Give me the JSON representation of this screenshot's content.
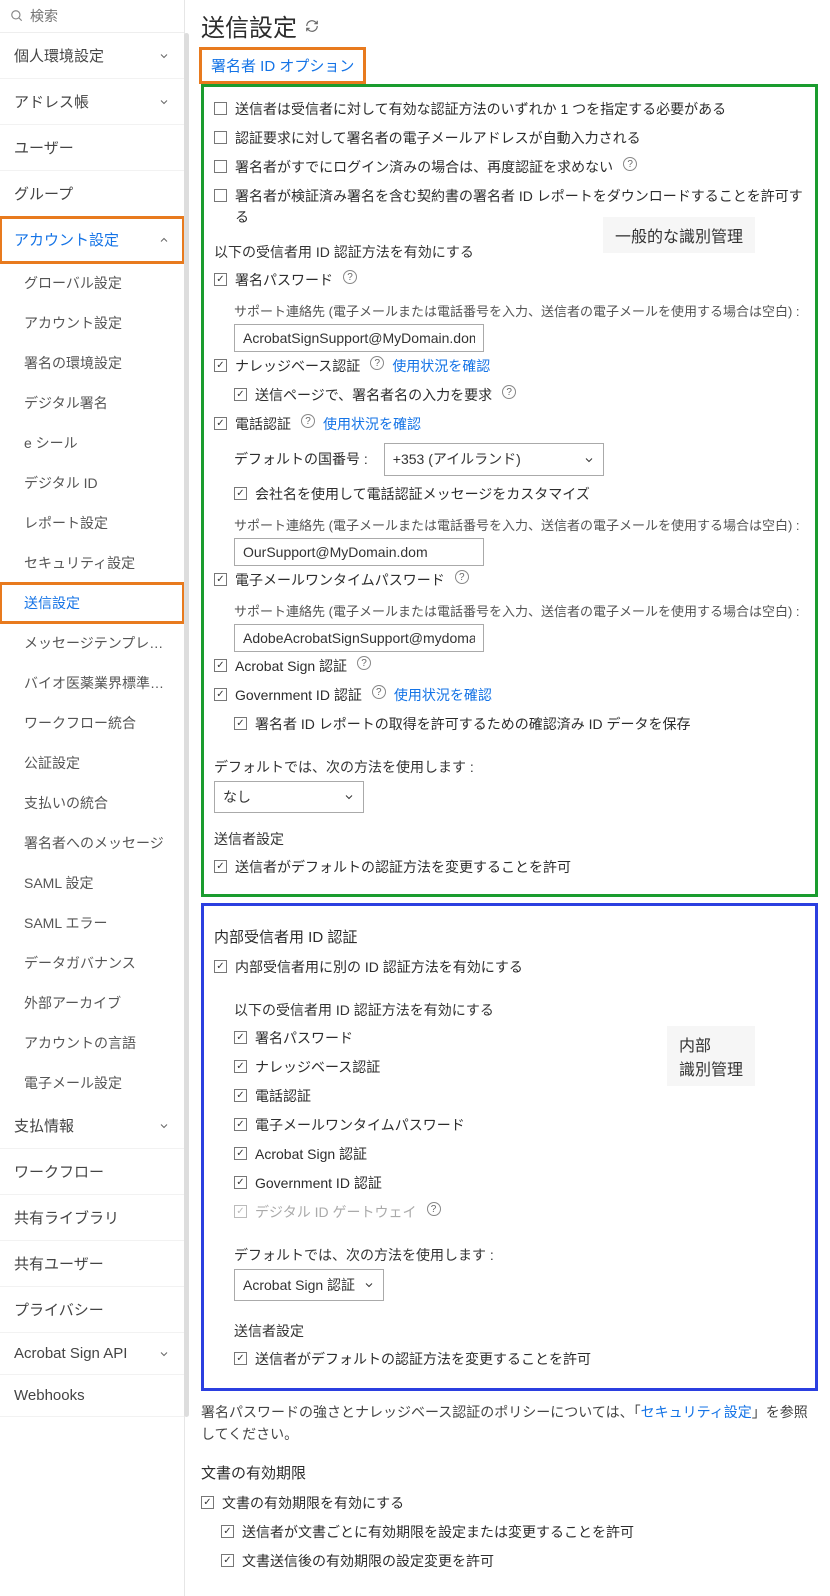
{
  "search": {
    "placeholder": "検索"
  },
  "sidebar": {
    "top": [
      {
        "label": "個人環境設定",
        "exp": "down"
      },
      {
        "label": "アドレス帳",
        "exp": "down"
      },
      {
        "label": "ユーザー"
      },
      {
        "label": "グループ"
      },
      {
        "label": "アカウント設定",
        "exp": "up",
        "highlight": true,
        "active": true
      }
    ],
    "sub": [
      "グローバル設定",
      "アカウント設定",
      "署名の環境設定",
      "デジタル署名",
      "e シール",
      "デジタル ID",
      "レポート設定",
      "セキュリティ設定",
      "送信設定",
      "メッセージテンプレ…",
      "バイオ医薬業界標準…",
      "ワークフロー統合",
      "公証設定",
      "支払いの統合",
      "署名者へのメッセージ",
      "SAML 設定",
      "SAML エラー",
      "データガバナンス",
      "外部アーカイブ",
      "アカウントの言語",
      "電子メール設定"
    ],
    "sub_active_index": 8,
    "bottom": [
      {
        "label": "支払情報",
        "exp": "down"
      },
      {
        "label": "ワークフロー"
      },
      {
        "label": "共有ライブラリ"
      },
      {
        "label": "共有ユーザー"
      },
      {
        "label": "プライバシー"
      },
      {
        "label": "Acrobat Sign API",
        "exp": "down"
      },
      {
        "label": "Webhooks"
      }
    ]
  },
  "page": {
    "title": "送信設定",
    "tab": "署名者 ID オプション",
    "annot_general": "一般的な識別管理",
    "annot_internal": "内部\n識別管理",
    "top_checks": [
      "送信者は受信者に対して有効な認証方法のいずれか 1 つを指定する必要がある",
      "認証要求に対して署名者の電子メールアドレスが自動入力される",
      "署名者がすでにログイン済みの場合は、再度認証を求めない",
      "署名者が検証済み署名を含む契約書の署名者 ID レポートをダウンロードすることを許可する"
    ],
    "enable_label": "以下の受信者用 ID 認証方法を有効にする",
    "signpw": "署名パスワード",
    "support_label": "サポート連絡先 (電子メールまたは電話番号を入力、送信者の電子メールを使用する場合は空白) :",
    "support1": "AcrobatSignSupport@MyDomain.dom",
    "kba": "ナレッジベース認証",
    "usage_link": "使用状況を確認",
    "kba_sub": "送信ページで、署名者名の入力を要求",
    "phone": "電話認証",
    "default_country_label": "デフォルトの国番号 :",
    "default_country_value": "+353 (アイルランド)",
    "phone_sub": "会社名を使用して電話認証メッセージをカスタマイズ",
    "support2": "OurSupport@MyDomain.dom",
    "email_otp": "電子メールワンタイムパスワード",
    "support3": "AdobeAcrobatSignSupport@mydomain.dom",
    "acrobat_auth": "Acrobat Sign 認証",
    "gov_id": "Government ID 認証",
    "gov_sub": "署名者 ID レポートの取得を許可するための確認済み ID データを保存",
    "default_method_label": "デフォルトでは、次の方法を使用します :",
    "default_method_value": "なし",
    "sender_settings": "送信者設定",
    "sender_allow": "送信者がデフォルトの認証方法を変更することを許可",
    "internal_title": "内部受信者用 ID 認証",
    "internal_enable": "内部受信者用に別の ID 認証方法を有効にする",
    "internal_methods": [
      "署名パスワード",
      "ナレッジベース認証",
      "電話認証",
      "電子メールワンタイムパスワード",
      "Acrobat Sign 認証",
      "Government ID 認証",
      "デジタル ID ゲートウェイ"
    ],
    "internal_default_value": "Acrobat Sign 認証",
    "footnote_pre": "署名パスワードの強さとナレッジベース認証のポリシーについては、「",
    "footnote_link": "セキュリティ設定",
    "footnote_post": "」を参照してください。",
    "doc_exp_title": "文書の有効期限",
    "doc_exp_enable": "文書の有効期限を有効にする",
    "doc_exp_sub1": "送信者が文書ごとに有効期限を設定または変更することを許可",
    "doc_exp_sub2": "文書送信後の有効期限の設定変更を許可"
  }
}
